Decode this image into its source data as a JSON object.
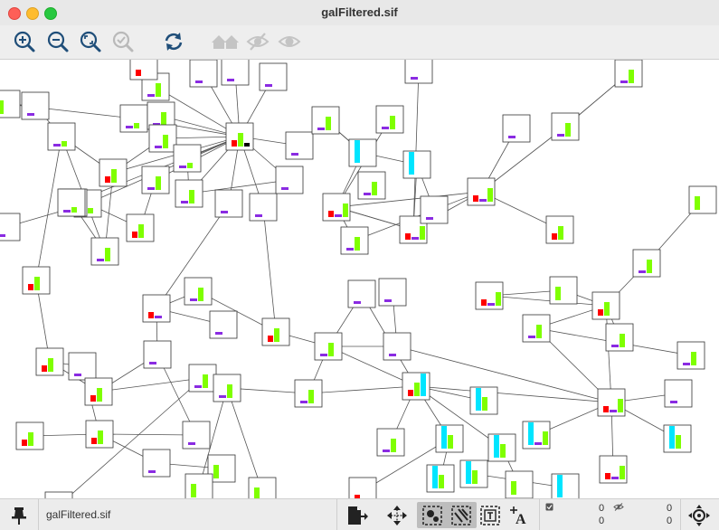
{
  "window": {
    "title": "galFiltered.sif"
  },
  "toolbar": {
    "buttons": [
      {
        "name": "zoom-in-button",
        "icon": "zoom-in-icon"
      },
      {
        "name": "zoom-out-button",
        "icon": "zoom-out-icon"
      },
      {
        "name": "zoom-fit-button",
        "icon": "zoom-fit-icon"
      },
      {
        "name": "zoom-selected-button",
        "icon": "zoom-selected-icon"
      },
      {
        "name": "refresh-button",
        "icon": "refresh-icon"
      },
      {
        "name": "show-all-button",
        "icon": "home-icon"
      },
      {
        "name": "hide-button",
        "icon": "hide-icon"
      },
      {
        "name": "show-button",
        "icon": "eye-icon"
      }
    ]
  },
  "status": {
    "network_name": "galFiltered.sif",
    "selected_nodes": "0",
    "hidden_nodes": "0",
    "selected_edges": "0",
    "hidden_edges": "0"
  },
  "colors": {
    "red": "#ff0000",
    "purple": "#8a2be2",
    "green": "#7fff00",
    "cyan": "#00e5ff",
    "toolbar_icon": "#1f4e79"
  }
}
